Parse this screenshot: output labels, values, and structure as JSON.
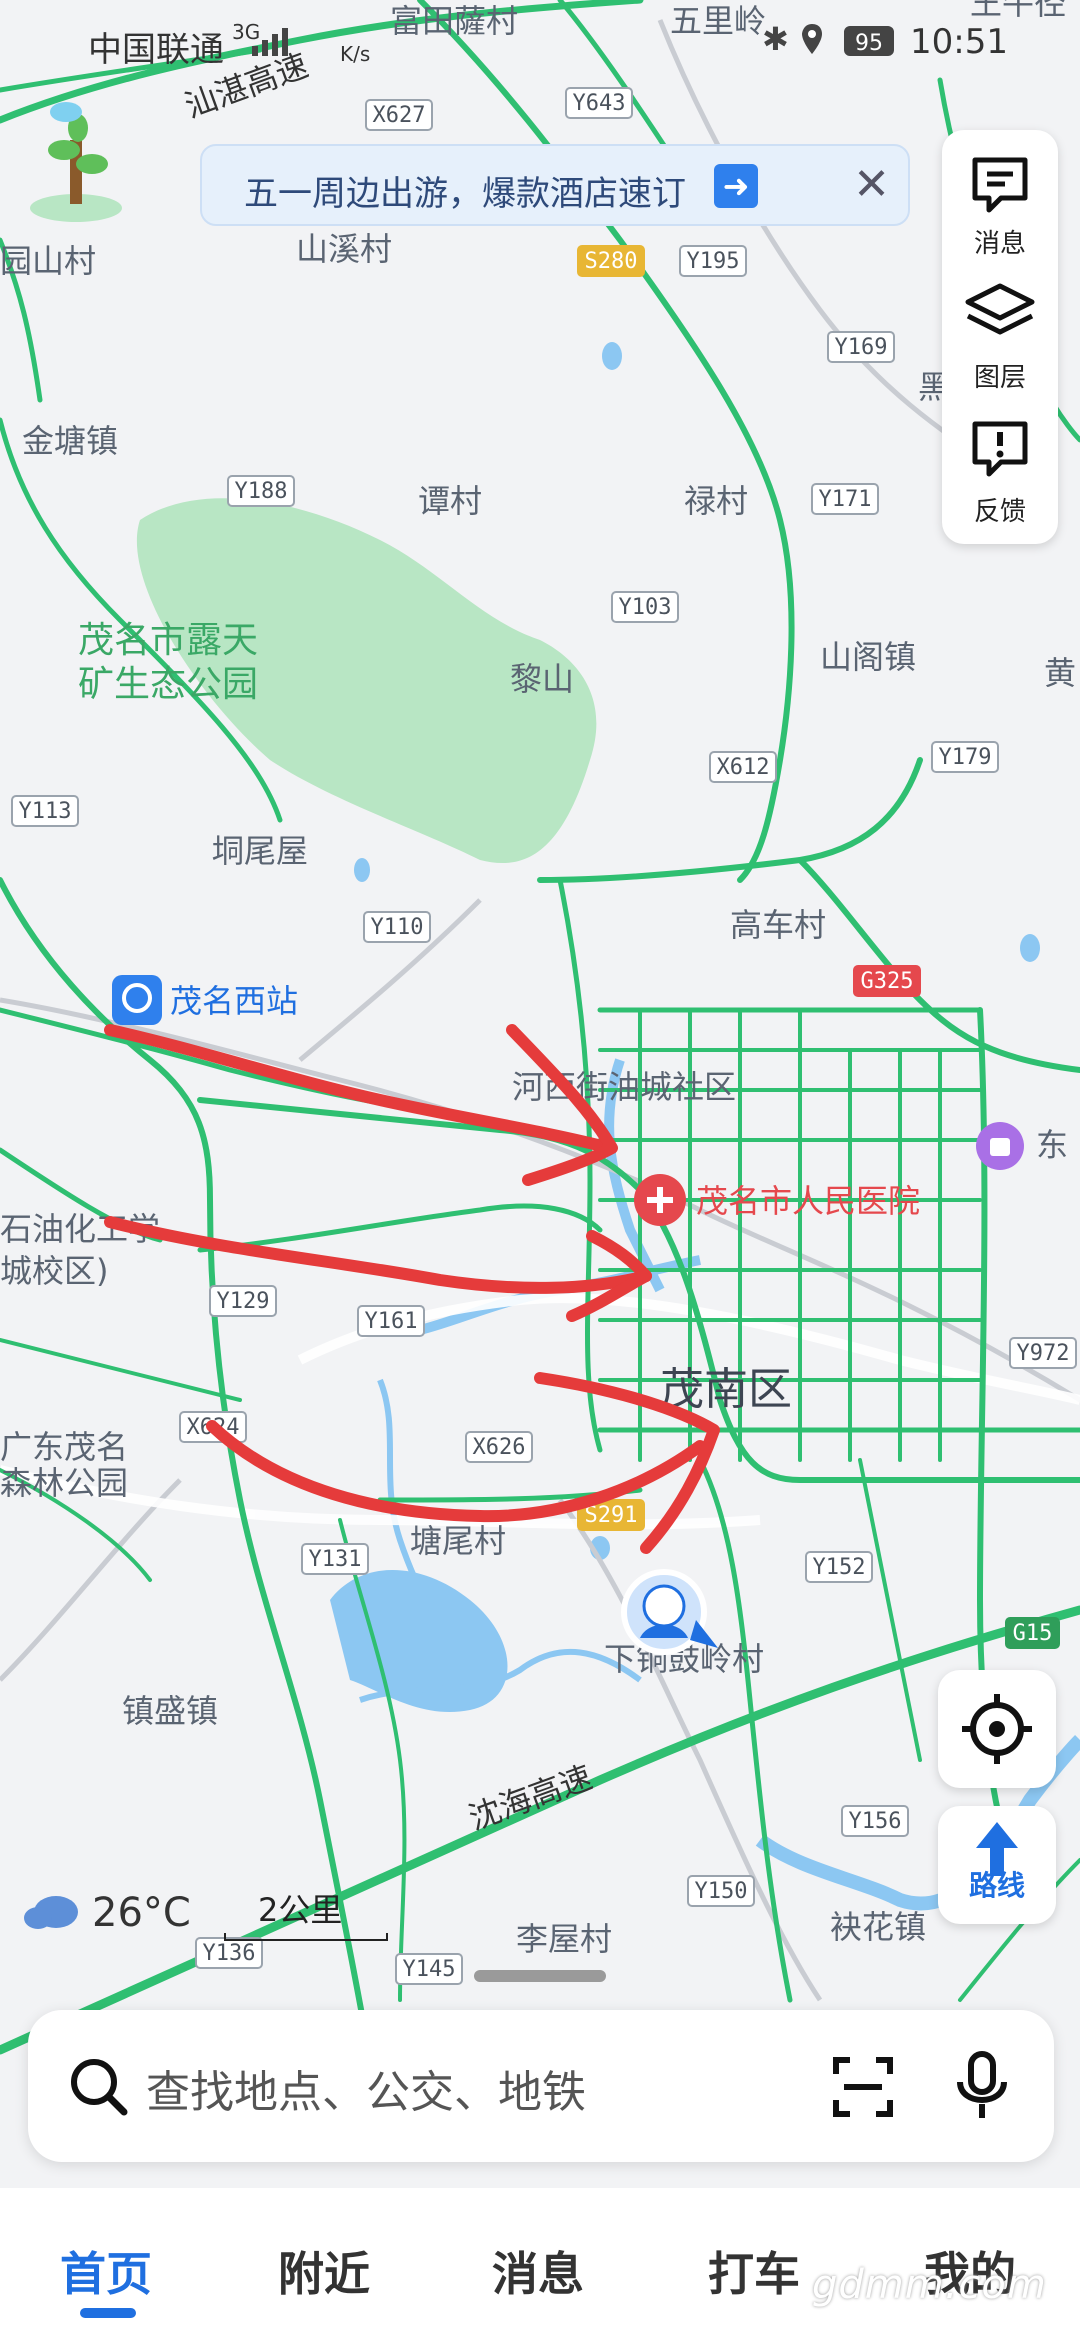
{
  "status_bar": {
    "carrier": "中国联通",
    "network": "3G",
    "speed_unit": "K/s",
    "battery": "95",
    "time": "10:51"
  },
  "banner": {
    "text": "五一周边出游，爆款酒店速订",
    "close_icon": "close-icon"
  },
  "side_panel": {
    "items": [
      {
        "label": "消息",
        "icon": "message-icon"
      },
      {
        "label": "图层",
        "icon": "layers-icon"
      },
      {
        "label": "反馈",
        "icon": "feedback-icon"
      }
    ]
  },
  "route_button": {
    "label": "路线"
  },
  "weather": {
    "temperature": "26°C"
  },
  "scale": {
    "label": "2公里"
  },
  "search": {
    "placeholder": "查找地点、公交、地铁"
  },
  "tabs": [
    {
      "label": "首页",
      "active": true
    },
    {
      "label": "附近",
      "active": false
    },
    {
      "label": "消息",
      "active": false
    },
    {
      "label": "打车",
      "active": false
    },
    {
      "label": "我的",
      "active": false
    }
  ],
  "watermark": "gdmm.com",
  "map": {
    "place_labels": [
      "富田薩村",
      "五里岭",
      "王牛径",
      "山溪村",
      "园山村",
      "金塘镇",
      "谭村",
      "禄村",
      "茂名市露天",
      "矿生态公园",
      "黎山",
      "山阁镇",
      "黄",
      "垌尾屋",
      "高车村",
      "茂名西站",
      "河西街油城社区",
      "东",
      "茂名市人民医院",
      "石油化工学",
      "城校区)",
      "茂南区",
      "广东茂名",
      "森林公园",
      "塘尾村",
      "下铜鼓岭村",
      "镇盛镇",
      "沈海高速",
      "汕湛高速",
      "李屋村",
      "袂花镇",
      "黑"
    ],
    "road_shields": [
      "X627",
      "Y643",
      "S280",
      "Y195",
      "Y169",
      "Y188",
      "Y171",
      "Y103",
      "X612",
      "Y179",
      "Y113",
      "Y110",
      "G325",
      "Y129",
      "Y161",
      "Y972",
      "X624",
      "X626",
      "S291",
      "Y131",
      "Y152",
      "G15",
      "Y156",
      "Y150",
      "Y136",
      "Y145"
    ],
    "colors": {
      "background": "#f2f3f5",
      "road_green": "#2fbf71",
      "park": "#b8e6c4",
      "water": "#8cc7f2",
      "annotation_red": "#e53b3b",
      "brand_blue": "#1f6fe0"
    }
  }
}
